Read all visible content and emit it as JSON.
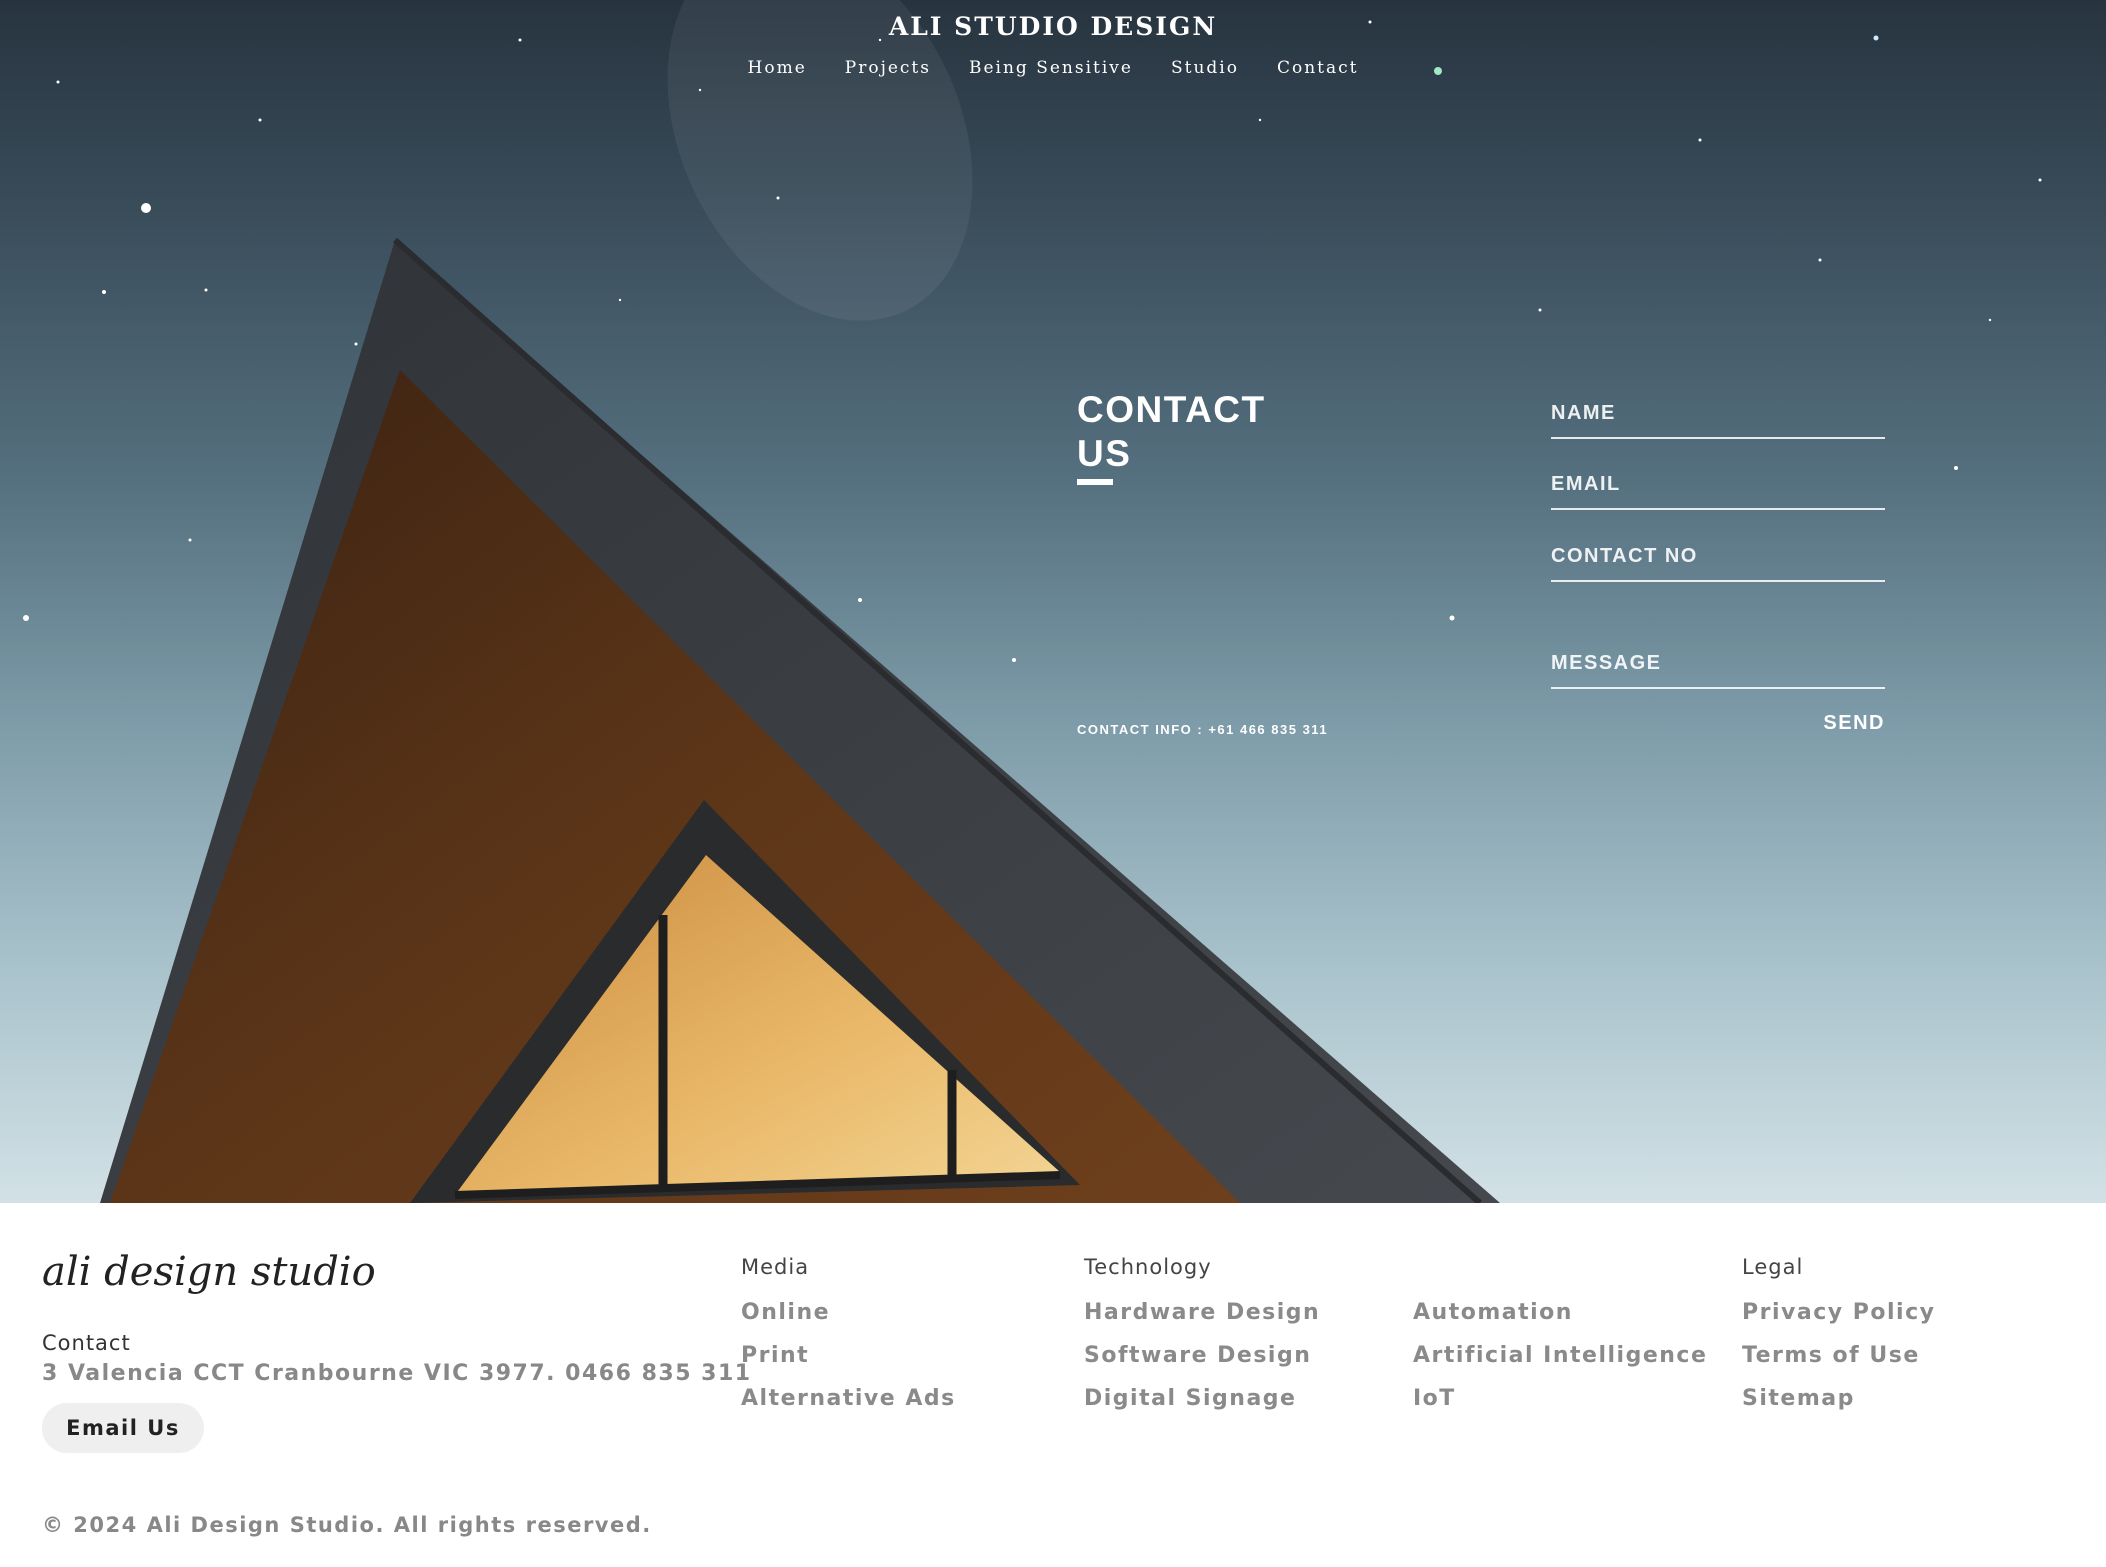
{
  "header": {
    "brand": "ALI STUDIO DESIGN",
    "nav": [
      "Home",
      "Projects",
      "Being Sensitive",
      "Studio",
      "Contact"
    ]
  },
  "contact": {
    "title": "CONTACT US",
    "info_label": "CONTACT INFO :",
    "info_phone": "+61 466 835 311",
    "form": {
      "name": "NAME",
      "email": "EMAIL",
      "contact_no": "CONTACT NO",
      "message": "MESSAGE",
      "send": "SEND"
    }
  },
  "footer": {
    "logo": "ali design studio",
    "contact_label": "Contact",
    "address": "3 Valencia CCT Cranbourne VIC 3977. 0466 835 311",
    "email_button": "Email Us",
    "columns": [
      {
        "heading": "Media",
        "items": [
          "Online",
          "Print",
          "Alternative Ads"
        ]
      },
      {
        "heading": "Technology",
        "items": [
          "Hardware Design",
          "Software Design",
          "Digital Signage"
        ]
      },
      {
        "heading": "",
        "items": [
          "Automation",
          "Artificial Intelligence",
          "IoT"
        ]
      },
      {
        "heading": "Legal",
        "items": [
          "Privacy Policy",
          "Terms of Use",
          "Sitemap"
        ]
      }
    ],
    "copyright": "© 2024 Ali Design Studio. All rights reserved."
  },
  "colors": {
    "sky_top": "#27343f",
    "sky_bottom": "#d2e1e6",
    "roof": "#3a3d40",
    "wood": "#5a3418",
    "window_glow": "#e9b96c"
  }
}
